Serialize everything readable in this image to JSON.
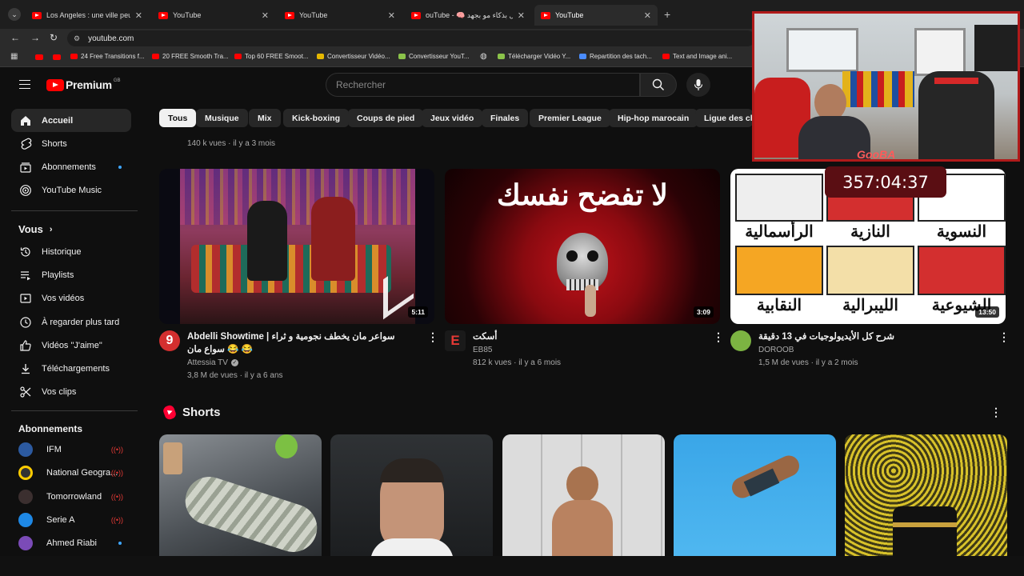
{
  "browser": {
    "tabs": [
      {
        "title": "Los Angeles : une ville peuplée"
      },
      {
        "title": "YouTube"
      },
      {
        "title": "YouTube"
      },
      {
        "title": "ouTube - 🧠 اعمل بذكاء مو بجهد"
      },
      {
        "title": "YouTube"
      }
    ],
    "url": "youtube.com",
    "bookmarks": [
      "24 Free Transitions f...",
      "20 FREE Smooth Tra...",
      "Top 60 FREE Smoot...",
      "Convertisseur Vidéo...",
      "Convertisseur YouT...",
      "Télécharger Vidéo Y...",
      "Repartition des tach...",
      "Text and Image ani..."
    ]
  },
  "header": {
    "logo": "Premium",
    "region": "GB",
    "search_placeholder": "Rechercher"
  },
  "sidebar": {
    "main": [
      {
        "label": "Accueil"
      },
      {
        "label": "Shorts"
      },
      {
        "label": "Abonnements"
      },
      {
        "label": "YouTube Music"
      }
    ],
    "you_title": "Vous",
    "you": [
      {
        "label": "Historique"
      },
      {
        "label": "Playlists"
      },
      {
        "label": "Vos vidéos"
      },
      {
        "label": "À regarder plus tard"
      },
      {
        "label": "Vidéos \"J'aime\""
      },
      {
        "label": "Téléchargements"
      },
      {
        "label": "Vos clips"
      }
    ],
    "subs_title": "Abonnements",
    "subs": [
      {
        "label": "IFM"
      },
      {
        "label": "National Geogra..."
      },
      {
        "label": "Tomorrowland"
      },
      {
        "label": "Serie A"
      },
      {
        "label": "Ahmed Riabi"
      }
    ]
  },
  "chips": [
    "Tous",
    "Musique",
    "Mix",
    "Kick-boxing",
    "Coups de pied",
    "Jeux vidéo",
    "Finales",
    "Premier League",
    "Hip-hop marocain",
    "Ligue des ch"
  ],
  "prev_row_meta": "140 k vues · il y a 3 mois",
  "videos": [
    {
      "title": "Abdelli Showtime | سواعر مان يخطف نجومية و ثراء سواع مان 😂 😂",
      "channel": "Attessia TV",
      "meta": "3,8 M de vues · il y a 6 ans",
      "duration": "5:11"
    },
    {
      "title": "أسكت",
      "channel": "EB85",
      "meta": "812 k vues · il y a 6 mois",
      "duration": "3:09",
      "thumb_text": "لا تفضح نفسك"
    },
    {
      "title": "شرح كل الأيديولوجيات في 13 دقيقة",
      "channel": "DOROOB",
      "meta": "1,5 M de vues · il y a 2 mois",
      "duration": "13:50",
      "thumb_labels": [
        "الرأسمالية",
        "النازية",
        "النسوية",
        "النقابية",
        "الليبرالية",
        "الشيوعية"
      ]
    }
  ],
  "shorts_title": "Shorts",
  "overlay": {
    "timer": "357:04:37",
    "stream_name": "GooBA"
  },
  "colors": {
    "accent": "#ff0000",
    "bg": "#0f0f0f",
    "chip": "#272727"
  }
}
